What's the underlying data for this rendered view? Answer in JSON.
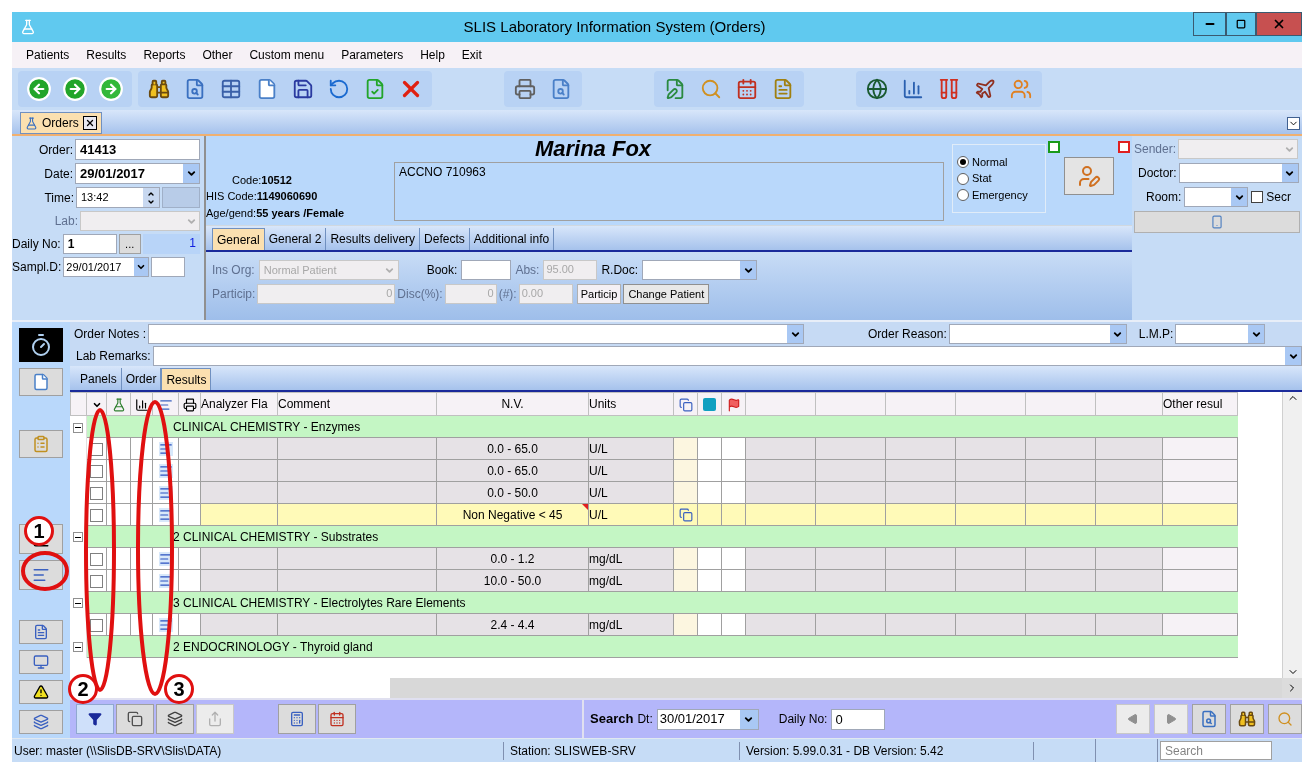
{
  "window": {
    "title": "SLIS Laboratory Information System (Orders)"
  },
  "menu": [
    "Patients",
    "Results",
    "Reports",
    "Other",
    "Custom menu",
    "Parameters",
    "Help",
    "Exit"
  ],
  "doc_tab": {
    "label": "Orders"
  },
  "order_form": {
    "order_label": "Order:",
    "order": "41413",
    "date_label": "Date:",
    "date": "29/01/2017",
    "time_label": "Time:",
    "time": "13:42",
    "lab_label": "Lab:",
    "daily_label": "Daily No:",
    "daily_no": "1",
    "daily_button": "...",
    "daily_count": "1",
    "sampl_label": "Sampl.D:",
    "sampl_date": "29/01/2017"
  },
  "patient": {
    "name": "Marina Fox",
    "code_label": "Code:",
    "code": "10512",
    "his_label": "HIS Code:",
    "his_code": "1149060690",
    "age_label": "Age/gend:",
    "age": "55 years /Female",
    "notes": "ACCNO 710963"
  },
  "priority": [
    {
      "label": "Normal",
      "selected": true
    },
    {
      "label": "Stat",
      "selected": false
    },
    {
      "label": "Emergency",
      "selected": false
    }
  ],
  "status_squares": [
    {
      "color": "#1a9a1a"
    },
    {
      "color": "#e02020"
    }
  ],
  "side_fields": {
    "sender_label": "Sender:",
    "doctor_label": "Doctor:",
    "room_label": "Room:",
    "secr_label": "Secr",
    "secr_checked": false
  },
  "info_tabs": [
    {
      "label": "General",
      "selected": true
    },
    {
      "label": "General 2",
      "selected": false
    },
    {
      "label": "Results delivery",
      "selected": false
    },
    {
      "label": "Defects",
      "selected": false
    },
    {
      "label": "Additional info",
      "selected": false
    }
  ],
  "general": {
    "ins_label": "Ins Org:",
    "ins_value": "Normal Patient",
    "book_label": "Book:",
    "abs_label": "Abs:",
    "abs_value": "95.00",
    "rdoc_label": "R.Doc:",
    "particip_label": "Particip:",
    "particip_value": "0",
    "disc_label": "Disc(%):",
    "disc_value": "0",
    "num_label": "(#):",
    "num_value": "0.00",
    "particip_button": "Particip",
    "change_button": "Change Patient"
  },
  "notes": {
    "order_notes_label": "Order Notes :",
    "order_reason_label": "Order Reason:",
    "lmp_label": "L.M.P:",
    "lab_remarks_label": "Lab Remarks:"
  },
  "result_tabs": [
    {
      "label": "Panels",
      "selected": false
    },
    {
      "label": "Order",
      "selected": false
    },
    {
      "label": "Results",
      "selected": true
    }
  ],
  "grid": {
    "columns": [
      "Analyzer Fla",
      "Comment",
      "N.V.",
      "Units",
      "Other resul"
    ],
    "groups": [
      {
        "label": "CLINICAL CHEMISTRY - Enzymes",
        "expanded": true,
        "rows": [
          {
            "checked": false,
            "highlighted": false,
            "nv": "0.0 - 65.0",
            "units": "U/L"
          },
          {
            "checked": false,
            "highlighted": false,
            "nv": "0.0 - 65.0",
            "units": "U/L"
          },
          {
            "checked": false,
            "highlighted": false,
            "nv": "0.0 - 50.0",
            "units": "U/L"
          },
          {
            "checked": false,
            "highlighted": true,
            "nv": "Non Negative < 45",
            "units": "U/L"
          }
        ]
      },
      {
        "label": "2 CLINICAL CHEMISTRY - Substrates",
        "expanded": true,
        "rows": [
          {
            "checked": false,
            "highlighted": false,
            "nv": "0.0 - 1.2",
            "units": "mg/dL"
          },
          {
            "checked": false,
            "highlighted": false,
            "nv": "10.0 - 50.0",
            "units": "mg/dL"
          }
        ]
      },
      {
        "label": "3 CLINICAL CHEMISTRY - Electrolytes Rare Elements",
        "expanded": true,
        "rows": [
          {
            "checked": false,
            "highlighted": false,
            "nv": "2.4 - 4.4",
            "units": "mg/dL"
          }
        ]
      },
      {
        "label": "2 ENDOCRINOLOGY - Thyroid gland",
        "expanded": true
      }
    ]
  },
  "search_bar": {
    "search_label": "Search",
    "dt_label": "Dt:",
    "date": "30/01/2017",
    "daily_label": "Daily No:",
    "daily_no": "0"
  },
  "status_bar": {
    "user": "User: master  (\\\\SlisDB-SRV\\Slis\\DATA)",
    "station": "Station: SLISWEB-SRV",
    "version": "Version: 5.99.0.31  -  DB Version: 5.42",
    "search_placeholder": "Search"
  },
  "annotations": [
    {
      "label": "1"
    },
    {
      "label": "2"
    },
    {
      "label": "3"
    }
  ]
}
